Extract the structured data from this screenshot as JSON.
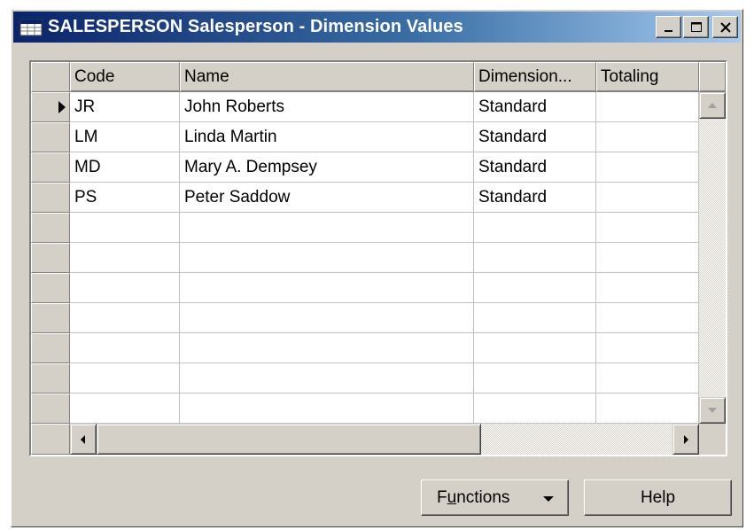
{
  "window": {
    "title": "SALESPERSON Salesperson - Dimension Values",
    "title_icon": "table-icon",
    "controls": [
      "minimize-icon",
      "maximize-icon",
      "close-icon"
    ]
  },
  "table": {
    "columns": [
      "Code",
      "Name",
      "Dimension...",
      "Totaling"
    ],
    "rows": [
      {
        "code": "JR",
        "name": "John Roberts",
        "dimension": "Standard",
        "totaling": ""
      },
      {
        "code": "LM",
        "name": "Linda Martin",
        "dimension": "Standard",
        "totaling": ""
      },
      {
        "code": "MD",
        "name": "Mary A. Dempsey",
        "dimension": "Standard",
        "totaling": ""
      },
      {
        "code": "PS",
        "name": "Peter Saddow",
        "dimension": "Standard",
        "totaling": ""
      }
    ],
    "empty_rows": 7,
    "current_row": 0
  },
  "buttons": {
    "functions_prefix": "F",
    "functions_mnemonic": "u",
    "functions_suffix": "nctions",
    "help": "Help"
  },
  "colors": {
    "titlebar_start": "#0a246a",
    "titlebar_end": "#a6caf0",
    "face": "#d4d0c8"
  }
}
